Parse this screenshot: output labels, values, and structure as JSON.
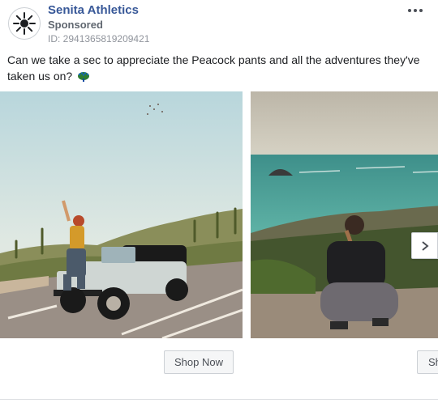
{
  "advertiser": {
    "name": "Senita Athletics",
    "sponsored_label": "Sponsored",
    "ad_id": "ID: 2941365819209421"
  },
  "post": {
    "caption": "Can we take a sec to appreciate the Peacock pants and all the adventures they've taken us on?",
    "caption_emoji_icon": "peacock-emoji-icon"
  },
  "menu": {
    "icon": "more-options-icon"
  },
  "carousel": {
    "cards": [
      {
        "image_icon": "woman-on-jeep-photo",
        "cta_label": "Shop Now"
      },
      {
        "image_icon": "woman-overlooking-ocean-photo",
        "cta_label": "Sh"
      }
    ],
    "next_icon": "chevron-right-icon"
  },
  "colors": {
    "brand_link": "#385898",
    "secondary_text": "#606770",
    "button_bg": "#f5f6f7"
  }
}
